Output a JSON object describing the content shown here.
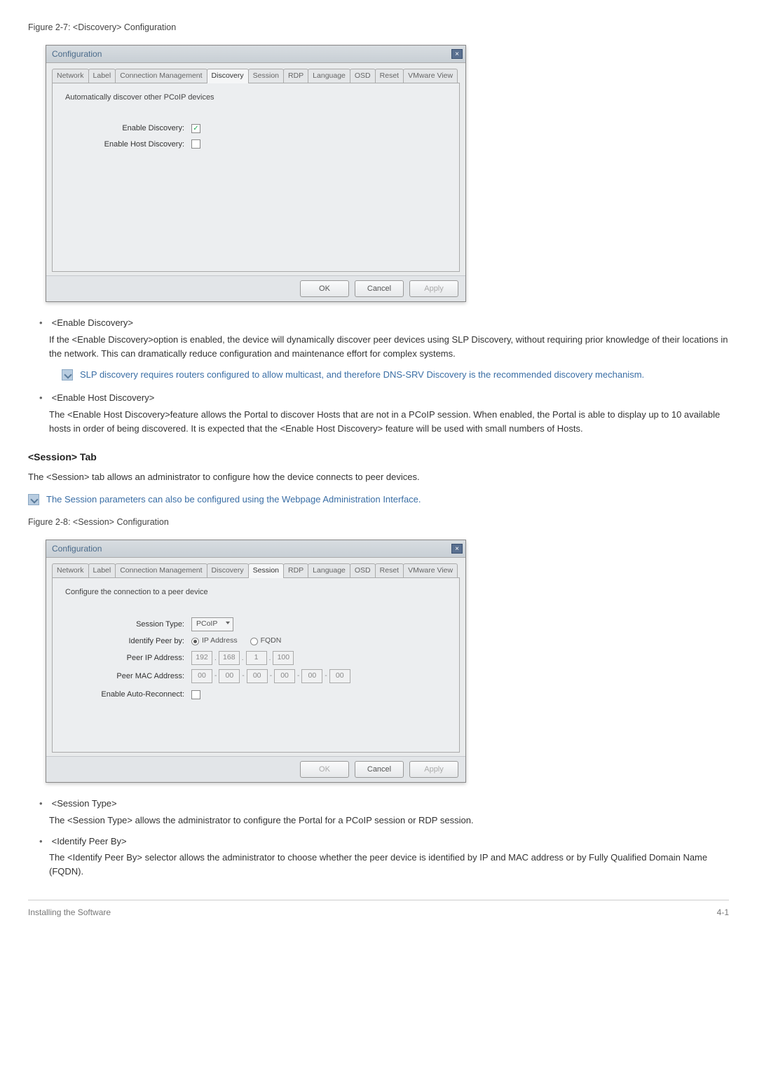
{
  "fig1_caption": "Figure 2-7: <Discovery> Configuration",
  "fig2_caption": "Figure 2-8: <Session> Configuration",
  "dialog": {
    "title": "Configuration",
    "tabs": [
      "Network",
      "Label",
      "Connection Management",
      "Discovery",
      "Session",
      "RDP",
      "Language",
      "OSD",
      "Reset",
      "VMware View"
    ],
    "buttons": {
      "ok": "OK",
      "cancel": "Cancel",
      "apply": "Apply"
    }
  },
  "discovery_panel": {
    "desc": "Automatically discover other PCoIP devices",
    "row1": "Enable Discovery:",
    "row2": "Enable Host Discovery:"
  },
  "session_panel": {
    "desc": "Configure the connection to a peer device",
    "session_type_lbl": "Session Type:",
    "session_type_val": "PCoIP",
    "identify_lbl": "Identify Peer by:",
    "identify_opt1": "IP Address",
    "identify_opt2": "FQDN",
    "peer_ip_lbl": "Peer IP Address:",
    "peer_ip": [
      "192",
      "168",
      "1",
      "100"
    ],
    "peer_mac_lbl": "Peer MAC Address:",
    "peer_mac": [
      "00",
      "00",
      "00",
      "00",
      "00",
      "00"
    ],
    "auto_reconnect_lbl": "Enable Auto-Reconnect:"
  },
  "bullet1": {
    "title": "<Enable Discovery>",
    "body": "If the <Enable Discovery>option is enabled, the device will dynamically discover peer devices using SLP Discovery, without requiring prior knowledge of their locations in the network. This can dramatically reduce configuration and maintenance effort for complex systems."
  },
  "note1": "SLP discovery requires routers configured to allow multicast, and therefore DNS-SRV Discovery is the recommended discovery mechanism.",
  "bullet2": {
    "title": "<Enable Host Discovery>",
    "body": "The <Enable Host Discovery>feature allows the Portal to discover Hosts that are not in a PCoIP session. When enabled, the Portal is able to display up to 10 available hosts in order of being discovered. It is expected that the <Enable Host Discovery> feature will be used with small numbers of Hosts."
  },
  "session_heading": "<Session> Tab",
  "session_intro": "The <Session> tab allows an administrator to configure how the device connects to peer devices.",
  "note2": "The Session parameters can also be configured using the Webpage Administration Interface.",
  "bullet3": {
    "title": "<Session Type>",
    "body": "The <Session Type> allows the administrator to configure the Portal for a PCoIP session or RDP session."
  },
  "bullet4": {
    "title": "<Identify Peer By>",
    "body": "The <Identify Peer By> selector allows the administrator to choose whether the peer device is identified by IP and MAC address or by Fully Qualified Domain Name (FQDN)."
  },
  "footer": {
    "left": "Installing the Software",
    "right": "4-1"
  }
}
